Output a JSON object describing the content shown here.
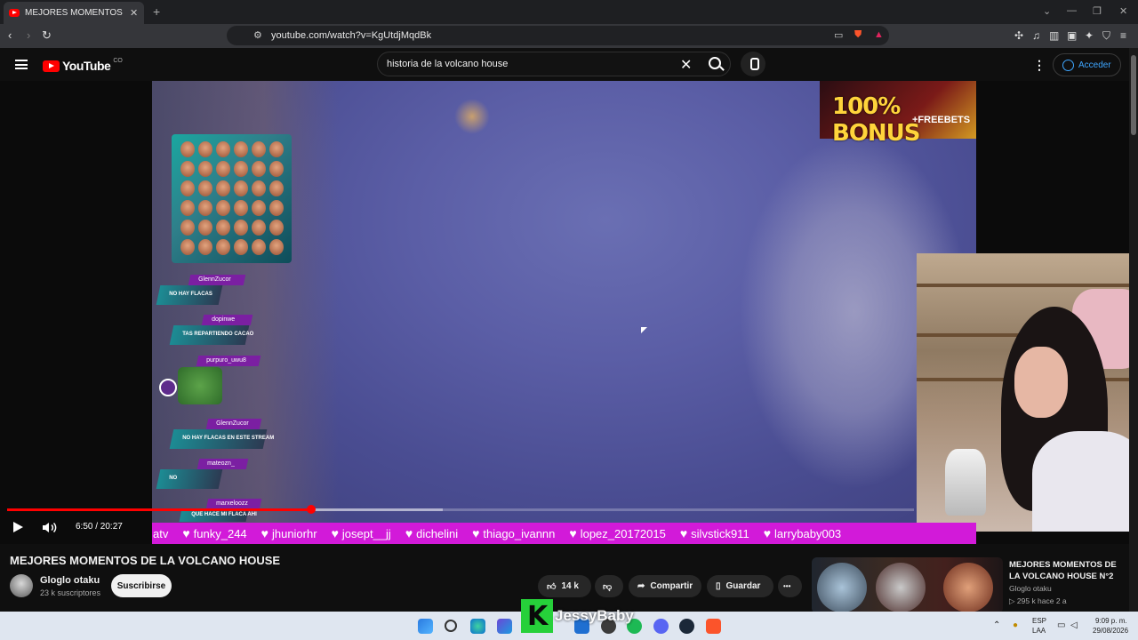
{
  "browser": {
    "tab_title": "MEJORES MOMENTOS DE LA VO",
    "tab_close": "✕",
    "new_tab": "+",
    "url": "youtube.com/watch?v=KgUtdjMqdBk"
  },
  "youtube": {
    "logo_text": "YouTube",
    "country_code": "CO",
    "search_query": "historia de la volcano house",
    "clear_glyph": "✕",
    "signin_label": "Acceder"
  },
  "video": {
    "bonus_big": "100% BONUS",
    "bonus_small": "+FREEBETS",
    "chat": [
      {
        "user": "GlennZucor",
        "msg": "NO HAY FLACAS"
      },
      {
        "user": "dopinwe",
        "msg": "TAS REPARTIENDO CACAO"
      },
      {
        "user": "purpuro_uwu8",
        "msg": ""
      },
      {
        "user": "GlennZucor",
        "msg": "NO HAY FLACAS EN ESTE STREAM"
      },
      {
        "user": "mateozn_",
        "msg": "NO"
      },
      {
        "user": "marxeloozz",
        "msg": "QUE HACE MI FLACA AHI"
      }
    ],
    "alerts": [
      "atv",
      "funky_244",
      "jhuniorhr",
      "josept__jj",
      "dichelini",
      "thiago_ivannn",
      "lopez_20172015",
      "silvstick911",
      "larrybaby003"
    ],
    "time": "6:50 / 20:27",
    "progress_fraction": 0.3356,
    "buffer_fraction": 0.48
  },
  "details": {
    "title": "MEJORES MOMENTOS DE LA VOLCANO HOUSE",
    "channel": "Gloglo otaku",
    "subscribers": "23 k suscriptores",
    "subscribe_label": "Suscribirse",
    "likes": "14 k",
    "share_label": "Compartir",
    "save_label": "Guardar",
    "more_label": "•••"
  },
  "recommendation": {
    "title": "MEJORES MOMENTOS DE LA VOLCANO HOUSE N°2",
    "channel": "Gloglo otaku",
    "meta": "▷ 295 k  hace 2 a"
  },
  "overlay": {
    "streamer_name": "JessyBaby",
    "k_letter": "K"
  },
  "taskbar": {
    "lang": "ESP",
    "lang2": "LAA",
    "time": "9:09 p. m.",
    "date": "29/08/2026"
  },
  "colors": {
    "yt_red": "#ff0000",
    "alert_bar": "#d21ad9",
    "link_blue": "#3ea6ff"
  }
}
